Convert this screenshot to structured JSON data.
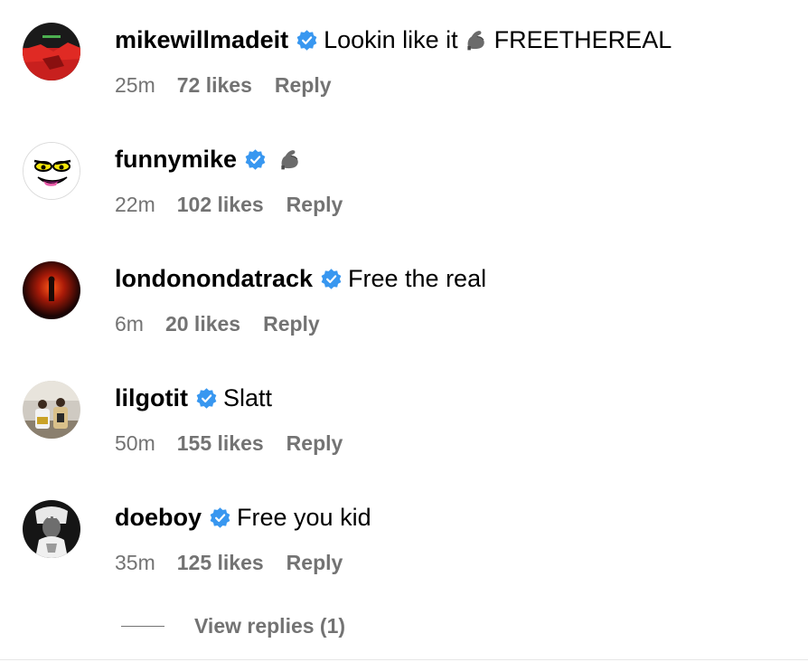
{
  "comments": [
    {
      "username": "mikewillmadeit",
      "verified": true,
      "text_before": "Lookin like it",
      "emoji": "flexed-biceps",
      "text_after": "FREETHEREAL",
      "time": "25m",
      "likes": "72 likes",
      "reply": "Reply",
      "avatar": "red-album-cover-avatar"
    },
    {
      "username": "funnymike",
      "verified": true,
      "text_before": "",
      "emoji": "flexed-biceps",
      "text_after": "",
      "time": "22m",
      "likes": "102 likes",
      "reply": "Reply",
      "avatar": "cartoon-face-avatar"
    },
    {
      "username": "londonondatrack",
      "verified": true,
      "text_before": "Free the real",
      "emoji": "",
      "text_after": "",
      "time": "6m",
      "likes": "20 likes",
      "reply": "Reply",
      "avatar": "dark-red-glow-avatar"
    },
    {
      "username": "lilgotit",
      "verified": true,
      "text_before": "Slatt",
      "emoji": "",
      "text_after": "",
      "time": "50m",
      "likes": "155 likes",
      "reply": "Reply",
      "avatar": "two-people-photo-avatar"
    },
    {
      "username": "doeboy",
      "verified": true,
      "text_before": "Free you kid",
      "emoji": "",
      "text_after": "",
      "time": "35m",
      "likes": "125 likes",
      "reply": "Reply",
      "avatar": "black-white-portrait-avatar"
    }
  ],
  "view_replies": {
    "label": "View replies (1)"
  },
  "colors": {
    "verified_blue": "#3897f0",
    "secondary_text": "#737373"
  }
}
